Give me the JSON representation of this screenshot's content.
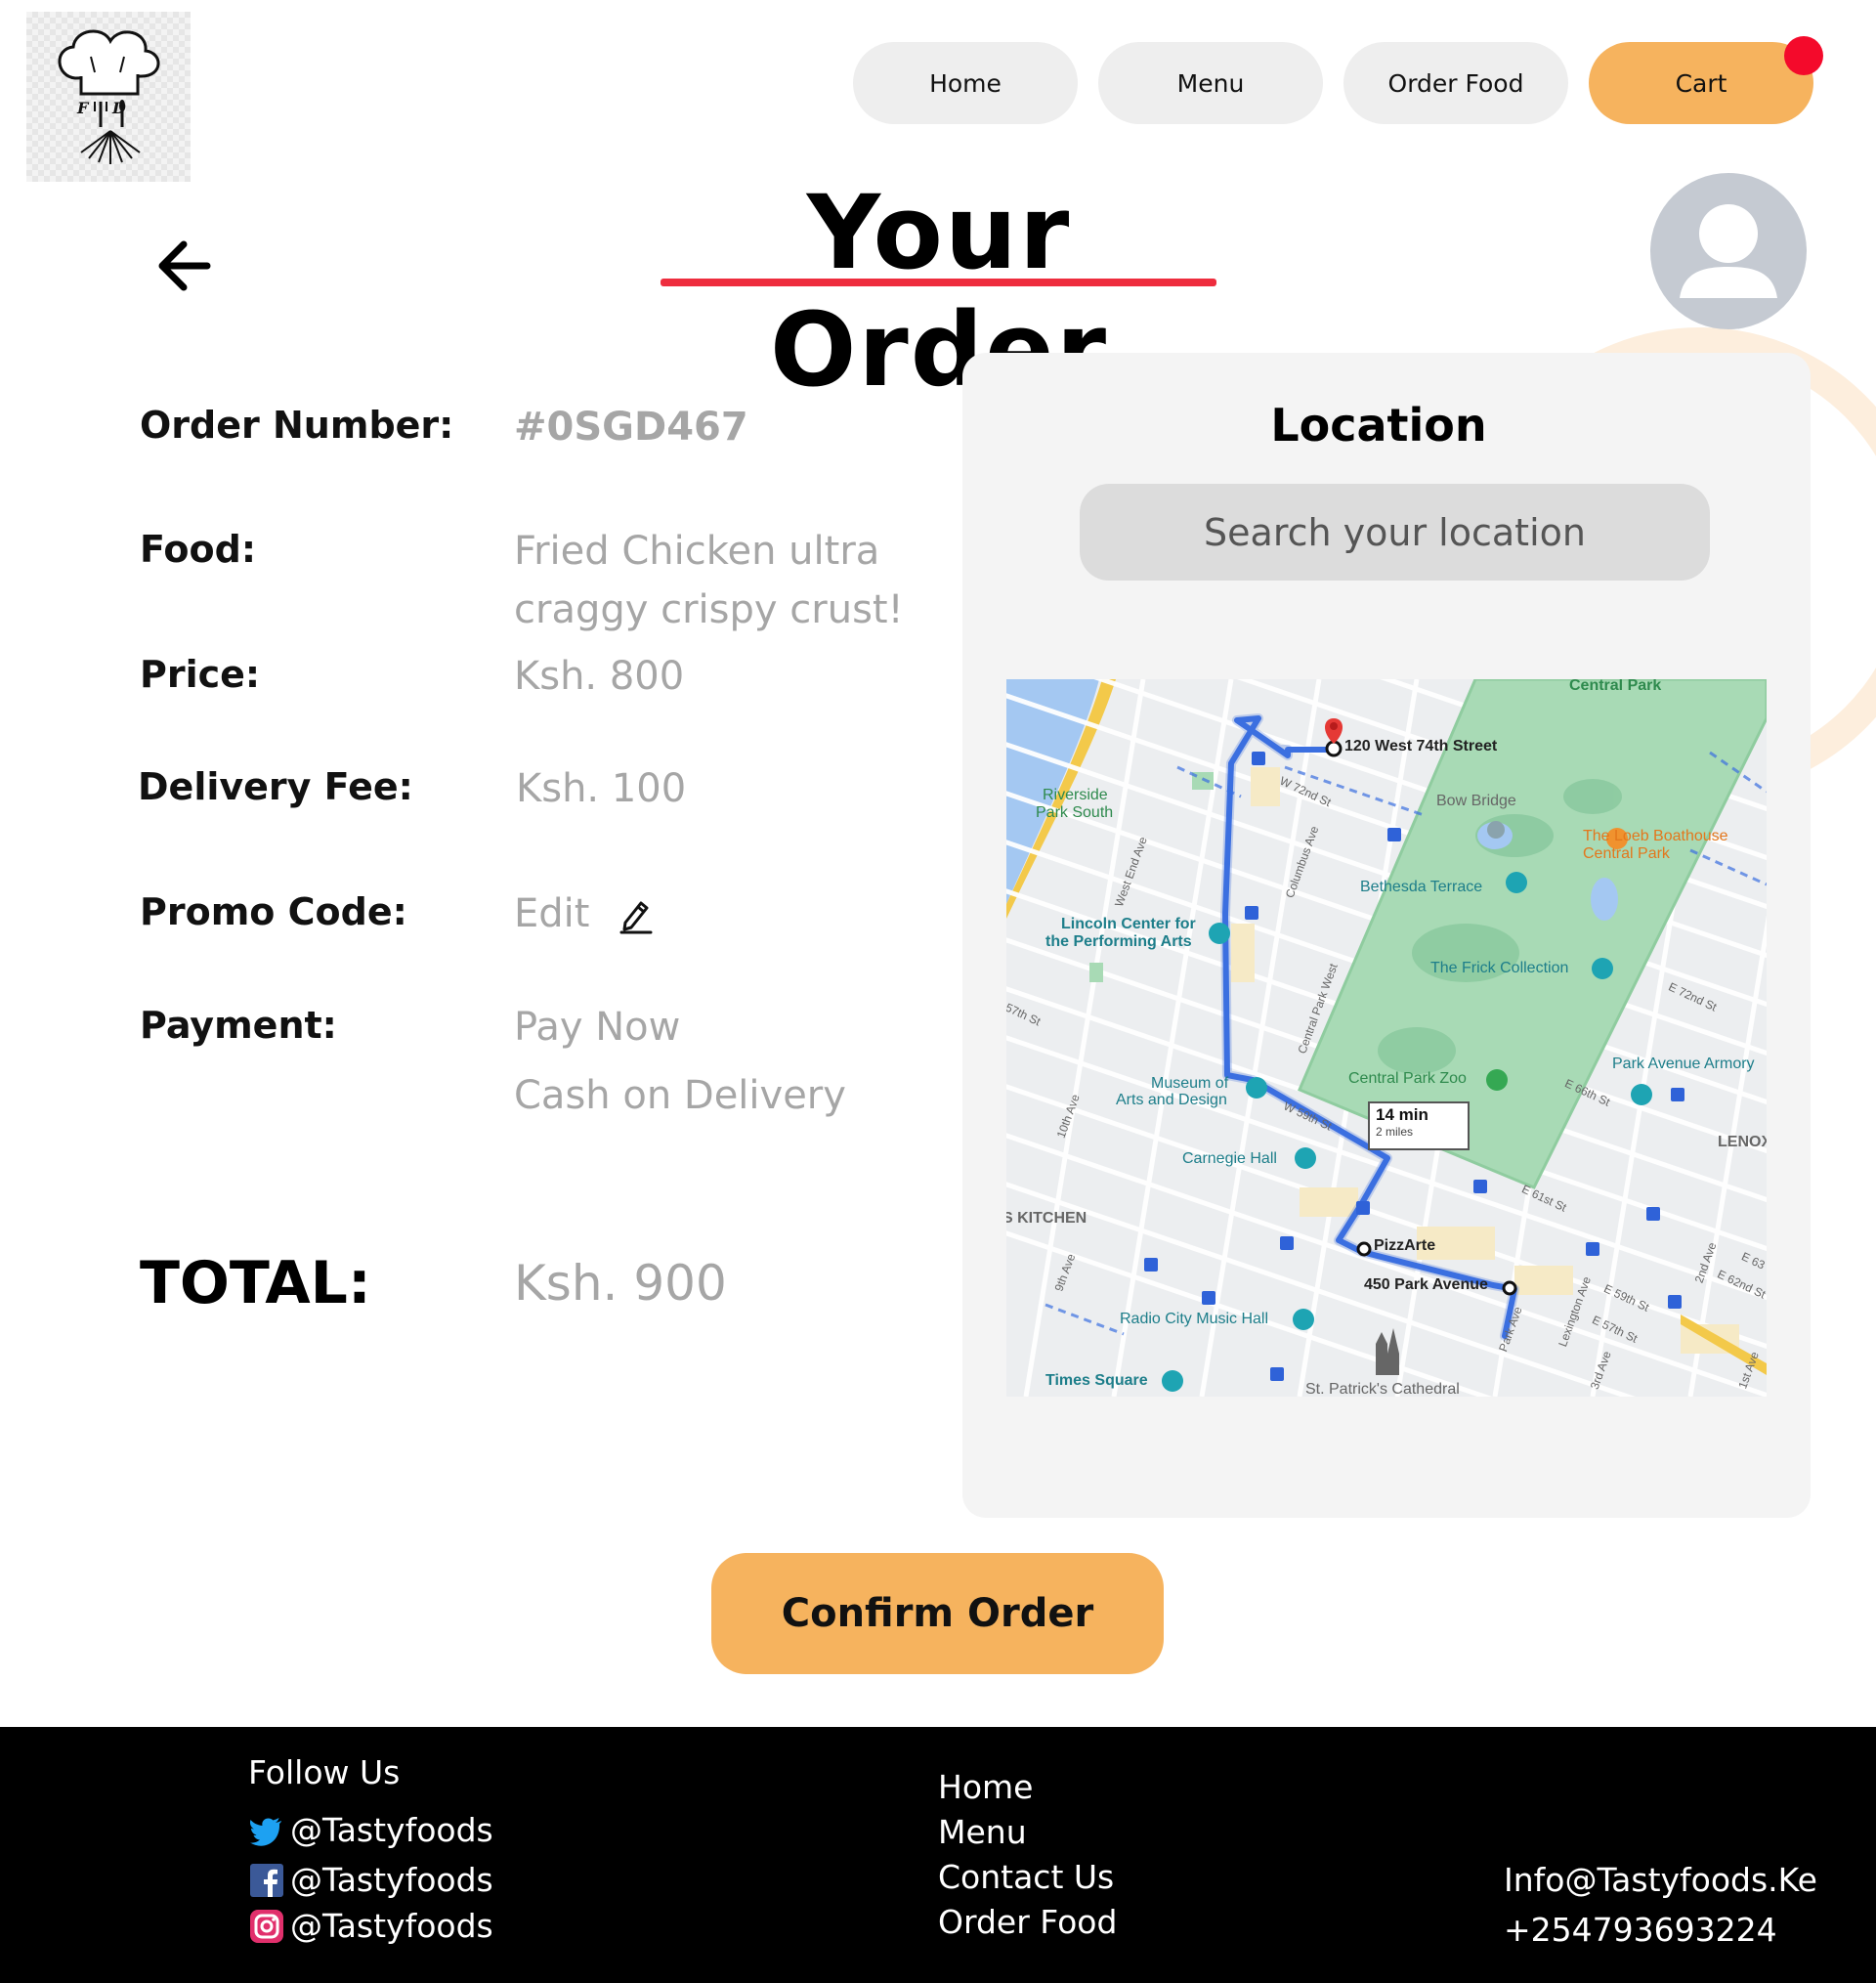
{
  "nav": {
    "items": [
      "Home",
      "Menu",
      "Order Food",
      "Cart"
    ]
  },
  "header": {
    "title": "Your Order"
  },
  "order": {
    "order_number_label": "Order Number:",
    "order_number": "#0SGD467",
    "food_label": "Food:",
    "food_line1": "Fried Chicken ultra",
    "food_line2": "craggy crispy crust!",
    "price_label": "Price:",
    "price": "Ksh. 800",
    "delivery_fee_label": "Delivery Fee:",
    "delivery_fee": "Ksh. 100",
    "promo_label": "Promo Code:",
    "promo_action": "Edit",
    "payment_label": "Payment:",
    "payment_options": [
      "Pay Now",
      "Cash on  Delivery"
    ],
    "total_label": "TOTAL:",
    "total": "Ksh. 900"
  },
  "location": {
    "title": "Location",
    "search_placeholder": "Search your location",
    "map": {
      "start": "120 West 74th Street",
      "stop": "PizzArte",
      "end": "450 Park Avenue",
      "eta_time": "14 min",
      "eta_distance": "2 miles",
      "labels": {
        "central_park": "Central Park",
        "riverside_1": "Riverside",
        "riverside_2": "Park South",
        "bow_bridge": "Bow Bridge",
        "loeb_1": "The Loeb Boathouse",
        "loeb_2": "Central Park",
        "bethesda": "Bethesda Terrace",
        "lincoln_1": "Lincoln Center for",
        "lincoln_2": "the Performing Arts",
        "frick": "The Frick Collection",
        "armory": "Park Avenue Armory",
        "zoo": "Central Park Zoo",
        "museum_1": "Museum of",
        "museum_2": "Arts and Design",
        "carnegie": "Carnegie Hall",
        "kitchen": "S KITCHEN",
        "lenox": "LENOX",
        "radio_city": "Radio City Music Hall",
        "times_square": "Times Square",
        "st_patricks": "St. Patrick's Cathedral",
        "w72": "W 72nd St",
        "columbus": "Columbus Ave",
        "west_end": "West End Ave",
        "cpw": "Central Park West",
        "w59": "W 59th St",
        "e72": "E 72nd St",
        "e66": "E 66th St",
        "e61": "E 61st St",
        "e59": "E 59th St",
        "e57": "E 57th St",
        "park_ave": "Park Ave",
        "lexington": "Lexington Ave",
        "second_ave": "2nd Ave",
        "third_ave": "3rd Ave",
        "first_ave": "1st Ave",
        "tenth_ave": "10th Ave",
        "ninth_ave": "9th Ave",
        "w57": "57th St",
        "e62": "E 62nd St",
        "e63": "E 63"
      }
    }
  },
  "actions": {
    "confirm": "Confirm Order"
  },
  "footer": {
    "follow_title": "Follow Us",
    "twitter": "@Tastyfoods",
    "facebook": "@Tastyfoods",
    "instagram": "@Tastyfoods",
    "links": [
      "Home",
      "Menu",
      "Contact Us",
      "Order Food"
    ],
    "email": "Info@Tastyfoods.Ke",
    "phone": "+254793693224"
  },
  "colors": {
    "accent": "#f6b35e",
    "title_underline": "#ee2d3e",
    "cart_badge": "#f40a2b",
    "muted_text": "#a6a6a6",
    "footer_bg": "#000000",
    "route": "#3b6fe0"
  },
  "icons": {
    "back": "arrow-left-icon",
    "profile": "user-avatar-icon",
    "edit": "pencil-icon",
    "twitter": "twitter-icon",
    "facebook": "facebook-icon",
    "instagram": "instagram-icon"
  }
}
